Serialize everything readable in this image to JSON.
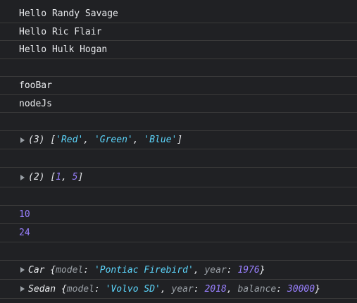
{
  "theme": {
    "background": "#202124",
    "text": "#e8eaed",
    "number_color": "#9980ff",
    "string_color": "#5cd5fb",
    "key_color": "#9aa0a6",
    "divider": "#3a3a3a"
  },
  "console": {
    "logs": [
      {
        "text": "Hello Randy Savage"
      },
      {
        "text": "Hello Ric Flair"
      },
      {
        "text": "Hello Hulk Hogan"
      },
      {
        "text": ""
      },
      {
        "text": "fooBar"
      },
      {
        "text": "nodeJs"
      },
      {
        "text": ""
      }
    ],
    "array1": {
      "count": "(3)",
      "open": "[",
      "items": [
        "'Red'",
        "'Green'",
        "'Blue'"
      ],
      "close": "]"
    },
    "array2": {
      "count": "(2)",
      "open": "[",
      "items": [
        "1",
        "5"
      ],
      "close": "]"
    },
    "numbers": [
      "10",
      "24"
    ],
    "car": {
      "class_name": "Car",
      "model_key": "model",
      "model_val": "'Pontiac Firebird'",
      "year_key": "year",
      "year_val": "1976"
    },
    "sedan": {
      "class_name": "Sedan",
      "model_key": "model",
      "model_val": "'Volvo SD'",
      "year_key": "year",
      "year_val": "2018",
      "balance_key": "balance",
      "balance_val": "30000"
    },
    "punctuation": {
      "comma": ", ",
      "colon": ": ",
      "brace_open": " {",
      "brace_close": "}"
    }
  }
}
